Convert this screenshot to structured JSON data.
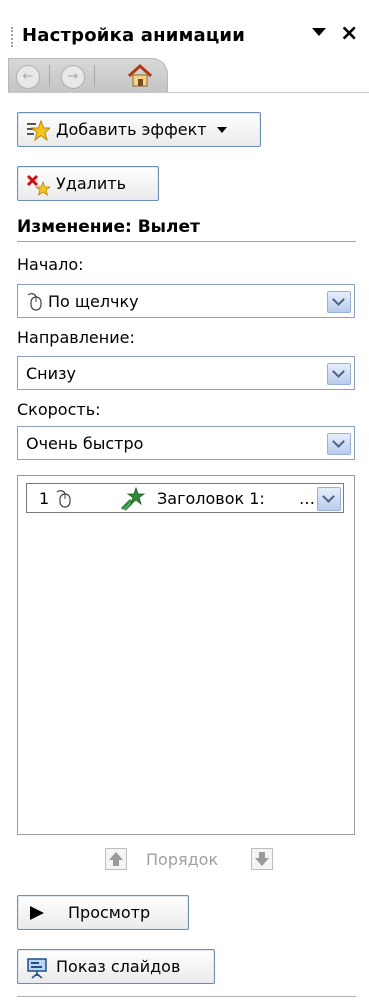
{
  "pane": {
    "title": "Настройка анимации",
    "close_glyph": "×"
  },
  "toolbar": {
    "add_effect_label": "Добавить эффект",
    "remove_label": "Удалить"
  },
  "modify": {
    "heading": "Изменение: Вылет",
    "start_label": "Начало:",
    "start_value": "По щелчку",
    "direction_label": "Направление:",
    "direction_value": "Снизу",
    "speed_label": "Скорость:",
    "speed_value": "Очень быстро"
  },
  "effects_list": [
    {
      "number": "1",
      "text": "Заголовок 1:",
      "ellipsis": "…"
    }
  ],
  "order": {
    "label": "Порядок"
  },
  "actions": {
    "preview_label": "Просмотр",
    "slideshow_label": "Показ слайдов"
  },
  "colors": {
    "button_border": "#6d8eb8",
    "combo_button": "#b9ccec",
    "star_yellow": "#f5c518",
    "star_green": "#2e8b3a"
  }
}
